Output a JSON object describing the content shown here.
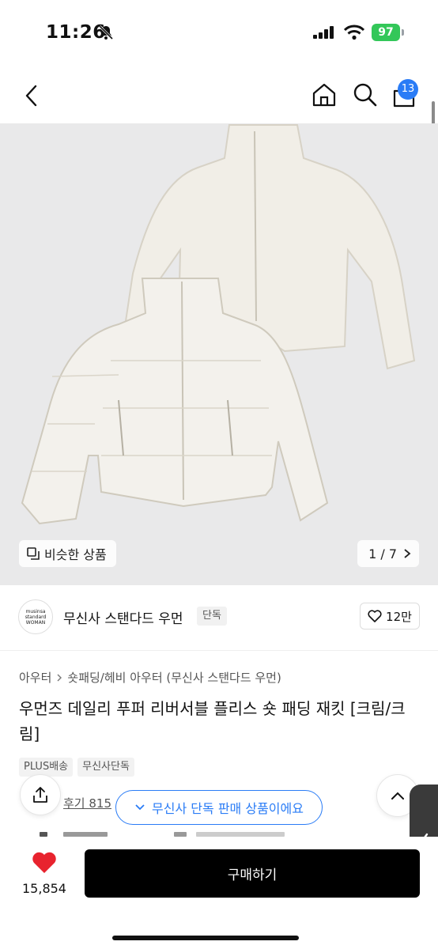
{
  "status_bar": {
    "time": "11:26",
    "battery": "97"
  },
  "nav": {
    "cart_count": "13"
  },
  "hero": {
    "similar_label": "비슷한 상품",
    "page_indicator": "1 / 7"
  },
  "brand": {
    "logo_lines": [
      "musinsa",
      "standard",
      "WOMAN"
    ],
    "name": "무신사 스탠다드 우먼",
    "exclusive_tag": "단독",
    "likes": "12만"
  },
  "breadcrumb": [
    "아우터",
    "숏패딩/헤비 아우터 (무신사 스탠다드 우먼)"
  ],
  "product": {
    "title": "우먼즈 데일리 푸퍼 리버서블 플리스 숏 패딩 재킷 [크림/크림]",
    "tags": [
      "PLUS배송",
      "무신사단독"
    ],
    "review_label": "후기 815"
  },
  "toast": {
    "text": "무신사 단독 판매 상품이에요"
  },
  "bottom": {
    "wish_count": "15,854",
    "buy_label": "구매하기"
  },
  "colors": {
    "accent": "#2a7cf6",
    "heart": "#e8232e",
    "buy_button": "#000000",
    "hero_bg": "#e9e9ea",
    "jacket": "#efece4"
  }
}
